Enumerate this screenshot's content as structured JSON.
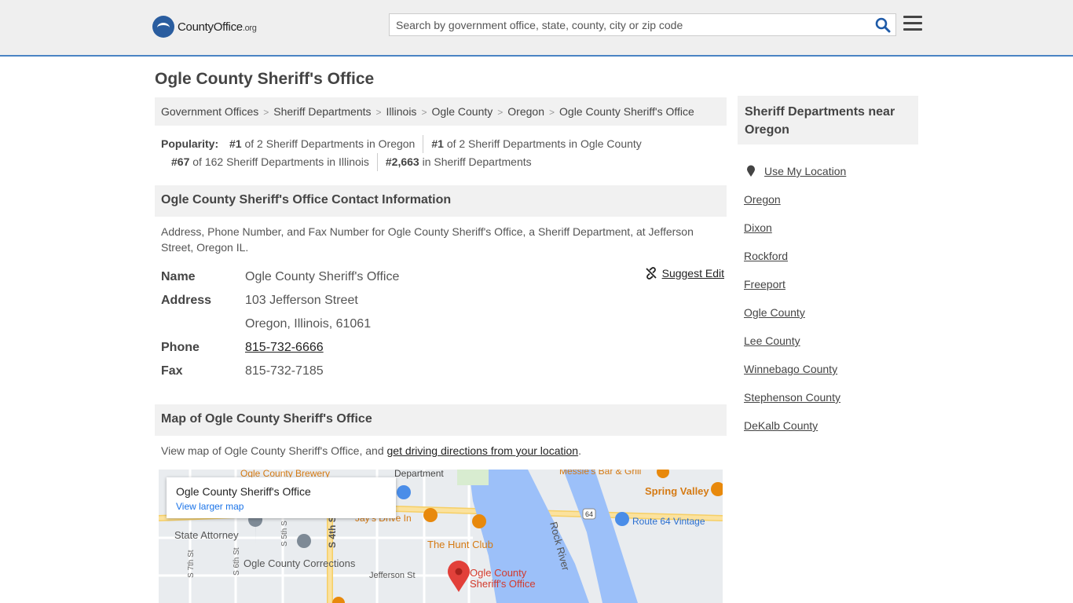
{
  "header": {
    "logo_text": "CountyOffice",
    "logo_suffix": ".org",
    "search_placeholder": "Search by government office, state, county, city or zip code"
  },
  "page_title": "Ogle County Sheriff's Office",
  "breadcrumb": [
    "Government Offices",
    "Sheriff Departments",
    "Illinois",
    "Ogle County",
    "Oregon",
    "Ogle County Sheriff's Office"
  ],
  "popularity": {
    "label": "Popularity:",
    "items": [
      {
        "rank": "#1",
        "text": "of 2 Sheriff Departments in Oregon"
      },
      {
        "rank": "#1",
        "text": "of 2 Sheriff Departments in Ogle County"
      },
      {
        "rank": "#67",
        "text": "of 162 Sheriff Departments in Illinois"
      },
      {
        "rank": "#2,663",
        "text": "in Sheriff Departments"
      }
    ]
  },
  "contact": {
    "heading": "Ogle County Sheriff's Office Contact Information",
    "description": "Address, Phone Number, and Fax Number for Ogle County Sheriff's Office, a Sheriff Department, at Jefferson Street, Oregon IL.",
    "suggest_edit": "Suggest Edit",
    "name_label": "Name",
    "name": "Ogle County Sheriff's Office",
    "address_label": "Address",
    "address_line1": "103 Jefferson Street",
    "address_line2": "Oregon, Illinois, 61061",
    "phone_label": "Phone",
    "phone": "815-732-6666",
    "fax_label": "Fax",
    "fax": "815-732-7185"
  },
  "map_section": {
    "heading": "Map of Ogle County Sheriff's Office",
    "desc_prefix": "View map of Ogle County Sheriff's Office, and ",
    "desc_link": "get driving directions from your location",
    "desc_suffix": ".",
    "card_title": "Ogle County Sheriff's Office",
    "card_link": "View larger map",
    "labels": {
      "brewery": "Ogle County Brewery",
      "department": "Department",
      "messies": "Messie's Bar & Grill",
      "spring_valley": "Spring Valley",
      "route64": "Route 64 Vintage",
      "shield": "64",
      "jays": "Jay's Drive In",
      "hunt_club": "The Hunt Club",
      "rock_river": "Rock River",
      "state_attorney": "State Attorney",
      "corrections": "Ogle County Corrections",
      "jefferson": "Jefferson St",
      "pin_label1": "Ogle County",
      "pin_label2": "Sheriff's Office",
      "s7th": "S 7th St",
      "s6th": "S 6th St",
      "s5th": "S 5th S",
      "s4th": "S 4th S"
    }
  },
  "sidebar": {
    "heading": "Sheriff Departments near Oregon",
    "use_location": "Use My Location",
    "links": [
      "Oregon",
      "Dixon",
      "Rockford",
      "Freeport",
      "Ogle County",
      "Lee County",
      "Winnebago County",
      "Stephenson County",
      "DeKalb County"
    ]
  },
  "colors": {
    "accent_border": "#4a84c4",
    "logo_blue": "#2a5d9f",
    "map_water": "#9cc0f9",
    "map_road": "#fbe29e",
    "map_pin": "#e2403a",
    "map_poi_orange": "#e8890c",
    "map_poi_blue": "#4a8de8"
  }
}
